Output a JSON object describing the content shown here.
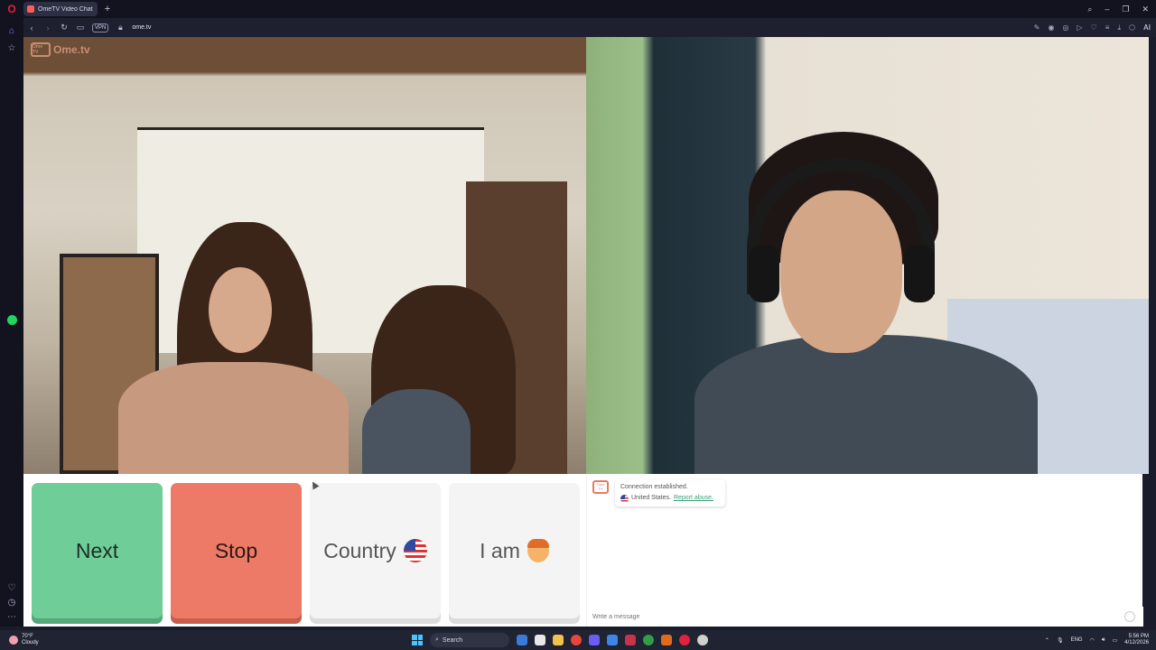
{
  "browser": {
    "tab_title": "OmeTV Video Chat -",
    "new_tab": "+",
    "url": "ome.tv",
    "vpn_label": "VPN",
    "ai_label": "AI"
  },
  "video": {
    "watermark": "Ome.tv",
    "watermark_box": "Ome TV"
  },
  "controls": {
    "next_label": "Next",
    "stop_label": "Stop",
    "country_label": "Country",
    "iam_label": "I am"
  },
  "chat": {
    "logo_text": "Ome TV",
    "status_line1": "Connection established.",
    "status_country": "United States.",
    "report_link": "Report abuse.",
    "input_placeholder": "Write a message"
  },
  "taskbar": {
    "temperature": "70°F",
    "weather": "Cloudy",
    "search_label": "Search",
    "language": "ENG",
    "time": "5:56 PM",
    "date": "4/12/2026"
  },
  "colors": {
    "next": "#6fcd98",
    "stop": "#ec7a66",
    "accent_link": "#3aa07a"
  },
  "icons": {
    "sidebar": [
      "home-icon",
      "star-icon",
      "spotify-icon",
      "heart-icon",
      "history-icon",
      "more-icon"
    ],
    "address_right": [
      "edit-icon",
      "camera-icon",
      "snapshot-icon",
      "play-icon",
      "heart-icon",
      "menu-icon",
      "download-icon",
      "extensions-icon"
    ]
  }
}
